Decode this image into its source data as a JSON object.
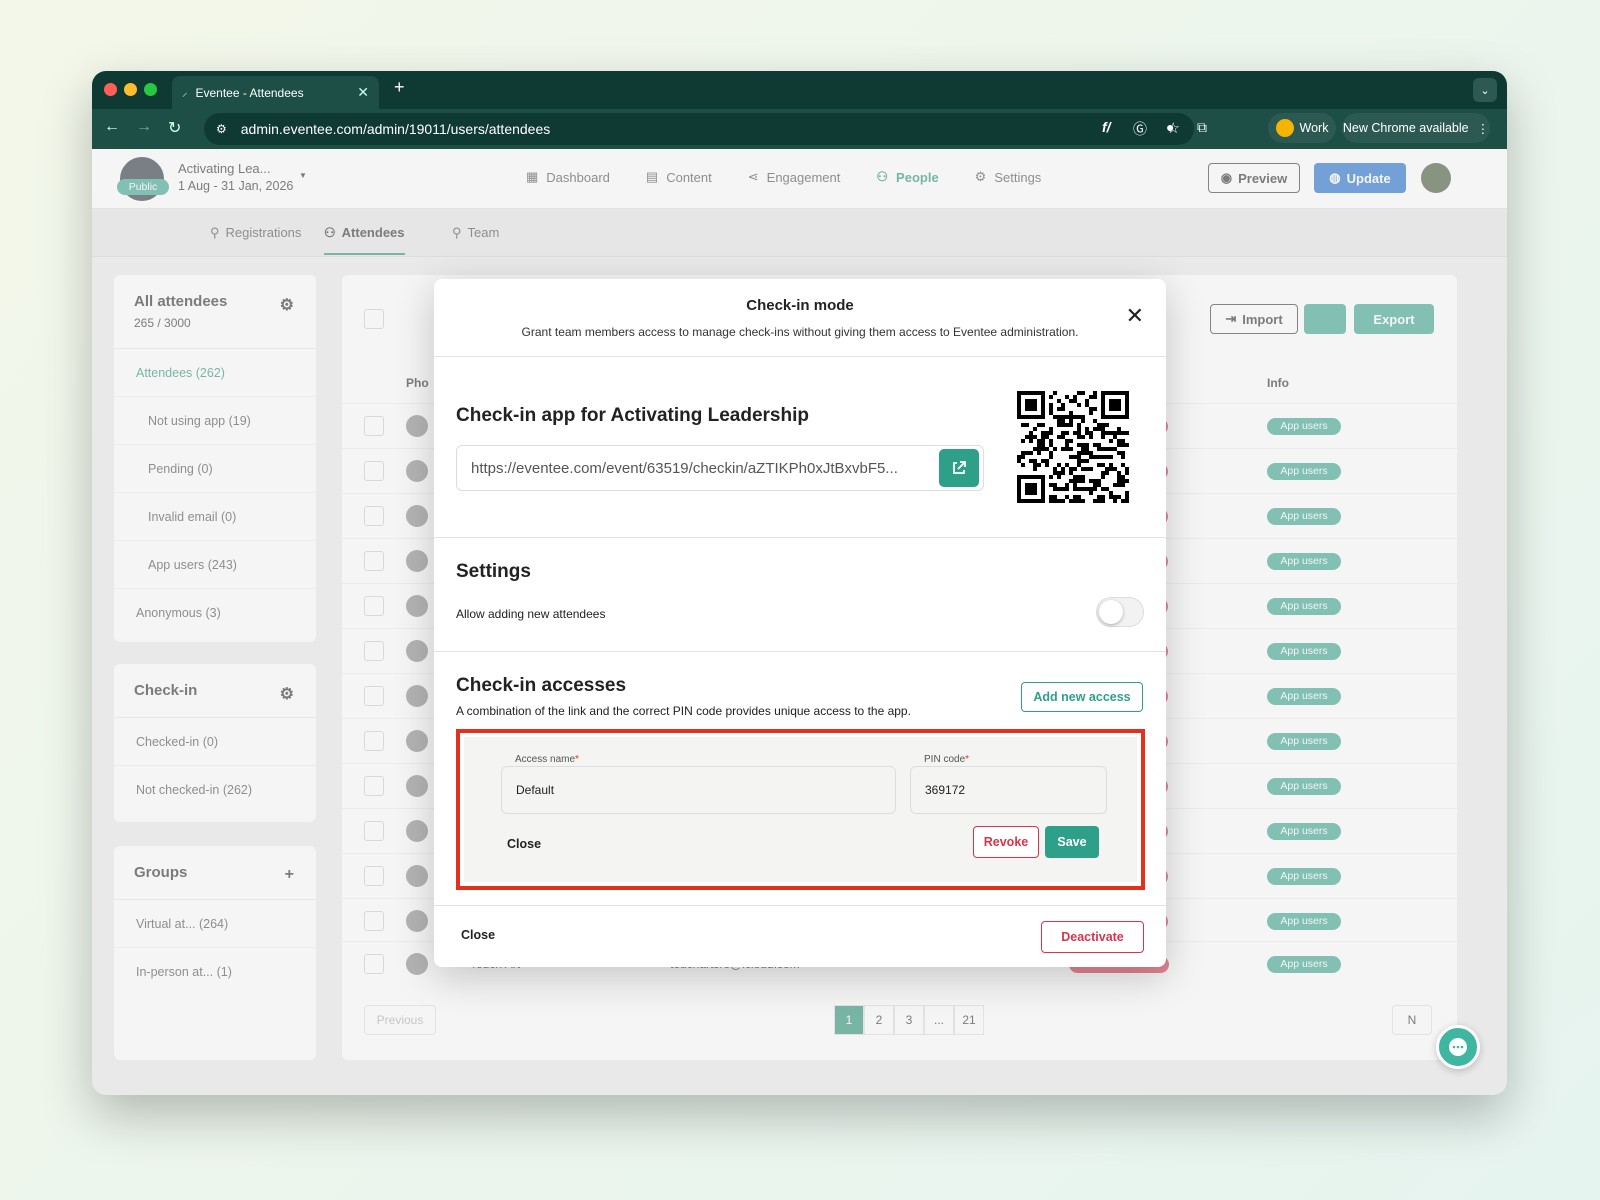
{
  "browser": {
    "tab_title": "Eventee - Attendees",
    "url": "admin.eventee.com/admin/19011/users/attendees",
    "profile_label": "Work",
    "update_label": "New Chrome available"
  },
  "header": {
    "badge": "Public",
    "event_name": "Activating Lea...",
    "event_dates": "1 Aug - 31 Jan, 2026",
    "nav": [
      "Dashboard",
      "Content",
      "Engagement",
      "People",
      "Settings"
    ],
    "active_nav": "People",
    "preview_label": "Preview",
    "update_label": "Update"
  },
  "subnav": [
    "Registrations",
    "Attendees",
    "Team"
  ],
  "sidebar": {
    "all": {
      "title": "All attendees",
      "count": "265 / 3000",
      "items": [
        "Attendees (262)",
        "Not using app (19)",
        "Pending (0)",
        "Invalid email (0)",
        "App users (243)",
        "Anonymous (3)"
      ]
    },
    "checkin": {
      "title": "Check-in",
      "items": [
        "Checked-in (0)",
        "Not checked-in (262)"
      ]
    },
    "groups": {
      "title": "Groups",
      "items": [
        "Virtual at... (264)",
        "In-person at... (1)"
      ]
    }
  },
  "table": {
    "col_photo": "Pho",
    "col_info": "Info",
    "import_label": "Import",
    "export_label": "Export",
    "badge_in": "-in",
    "badge_app": "App users",
    "last_row": {
      "name": "Touch Art",
      "email": "touchartsro@icloud.com",
      "dash": "-",
      "status": "Not checked-in",
      "info": "App users"
    },
    "prev_label": "Previous",
    "pages": [
      "1",
      "2",
      "3",
      "...",
      "21"
    ],
    "next_label": "N"
  },
  "modal": {
    "title": "Check-in mode",
    "subtitle": "Grant team members access to manage check-ins without giving them access to Eventee administration.",
    "app_heading": "Check-in app for Activating Leadership",
    "link": "https://eventee.com/event/63519/checkin/aZTIKPh0xJtBxvbF5...",
    "settings_heading": "Settings",
    "allow_label": "Allow adding new attendees",
    "allow_enabled": false,
    "accesses_heading": "Check-in accesses",
    "accesses_desc": "A combination of the link and the correct PIN code provides unique access to the app.",
    "add_access_label": "Add new access",
    "access": {
      "name_label": "Access name",
      "name_value": "Default",
      "pin_label": "PIN code",
      "pin_value": "369172",
      "close_label": "Close",
      "revoke_label": "Revoke",
      "save_label": "Save"
    },
    "footer_close": "Close",
    "deactivate_label": "Deactivate"
  },
  "colors": {
    "accent": "#2e9f88",
    "danger": "#d9344b",
    "highlight": "#e5301e",
    "brand_dark": "#0f3a34"
  }
}
